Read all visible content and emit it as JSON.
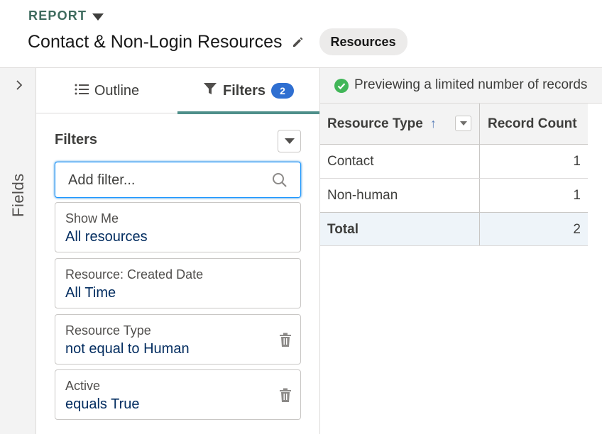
{
  "header": {
    "report_type": "REPORT",
    "title": "Contact & Non-Login Resources",
    "badge": "Resources"
  },
  "fields_rail": {
    "label": "Fields"
  },
  "tabs": {
    "outline": "Outline",
    "filters": "Filters",
    "filters_count": "2"
  },
  "filters_panel": {
    "heading": "Filters",
    "add_placeholder": "Add filter...",
    "items": [
      {
        "label": "Show Me",
        "value": "All resources",
        "removable": false
      },
      {
        "label": "Resource: Created Date",
        "value": "All Time",
        "removable": false
      },
      {
        "label": "Resource Type",
        "value": "not equal to Human",
        "removable": true
      },
      {
        "label": "Active",
        "value": "equals True",
        "removable": true
      }
    ]
  },
  "preview": {
    "message": "Previewing a limited number of records"
  },
  "table": {
    "columns": [
      "Resource Type",
      "Record Count"
    ],
    "sort_indicator": "↑",
    "rows": [
      {
        "type": "Contact",
        "count": "1"
      },
      {
        "type": "Non-human",
        "count": "1"
      }
    ],
    "total": {
      "label": "Total",
      "count": "2"
    }
  },
  "colors": {
    "accent_tab": "#4e8f8a",
    "count_pill": "#2f6fd1",
    "link_value": "#032d60",
    "success": "#41b658"
  }
}
